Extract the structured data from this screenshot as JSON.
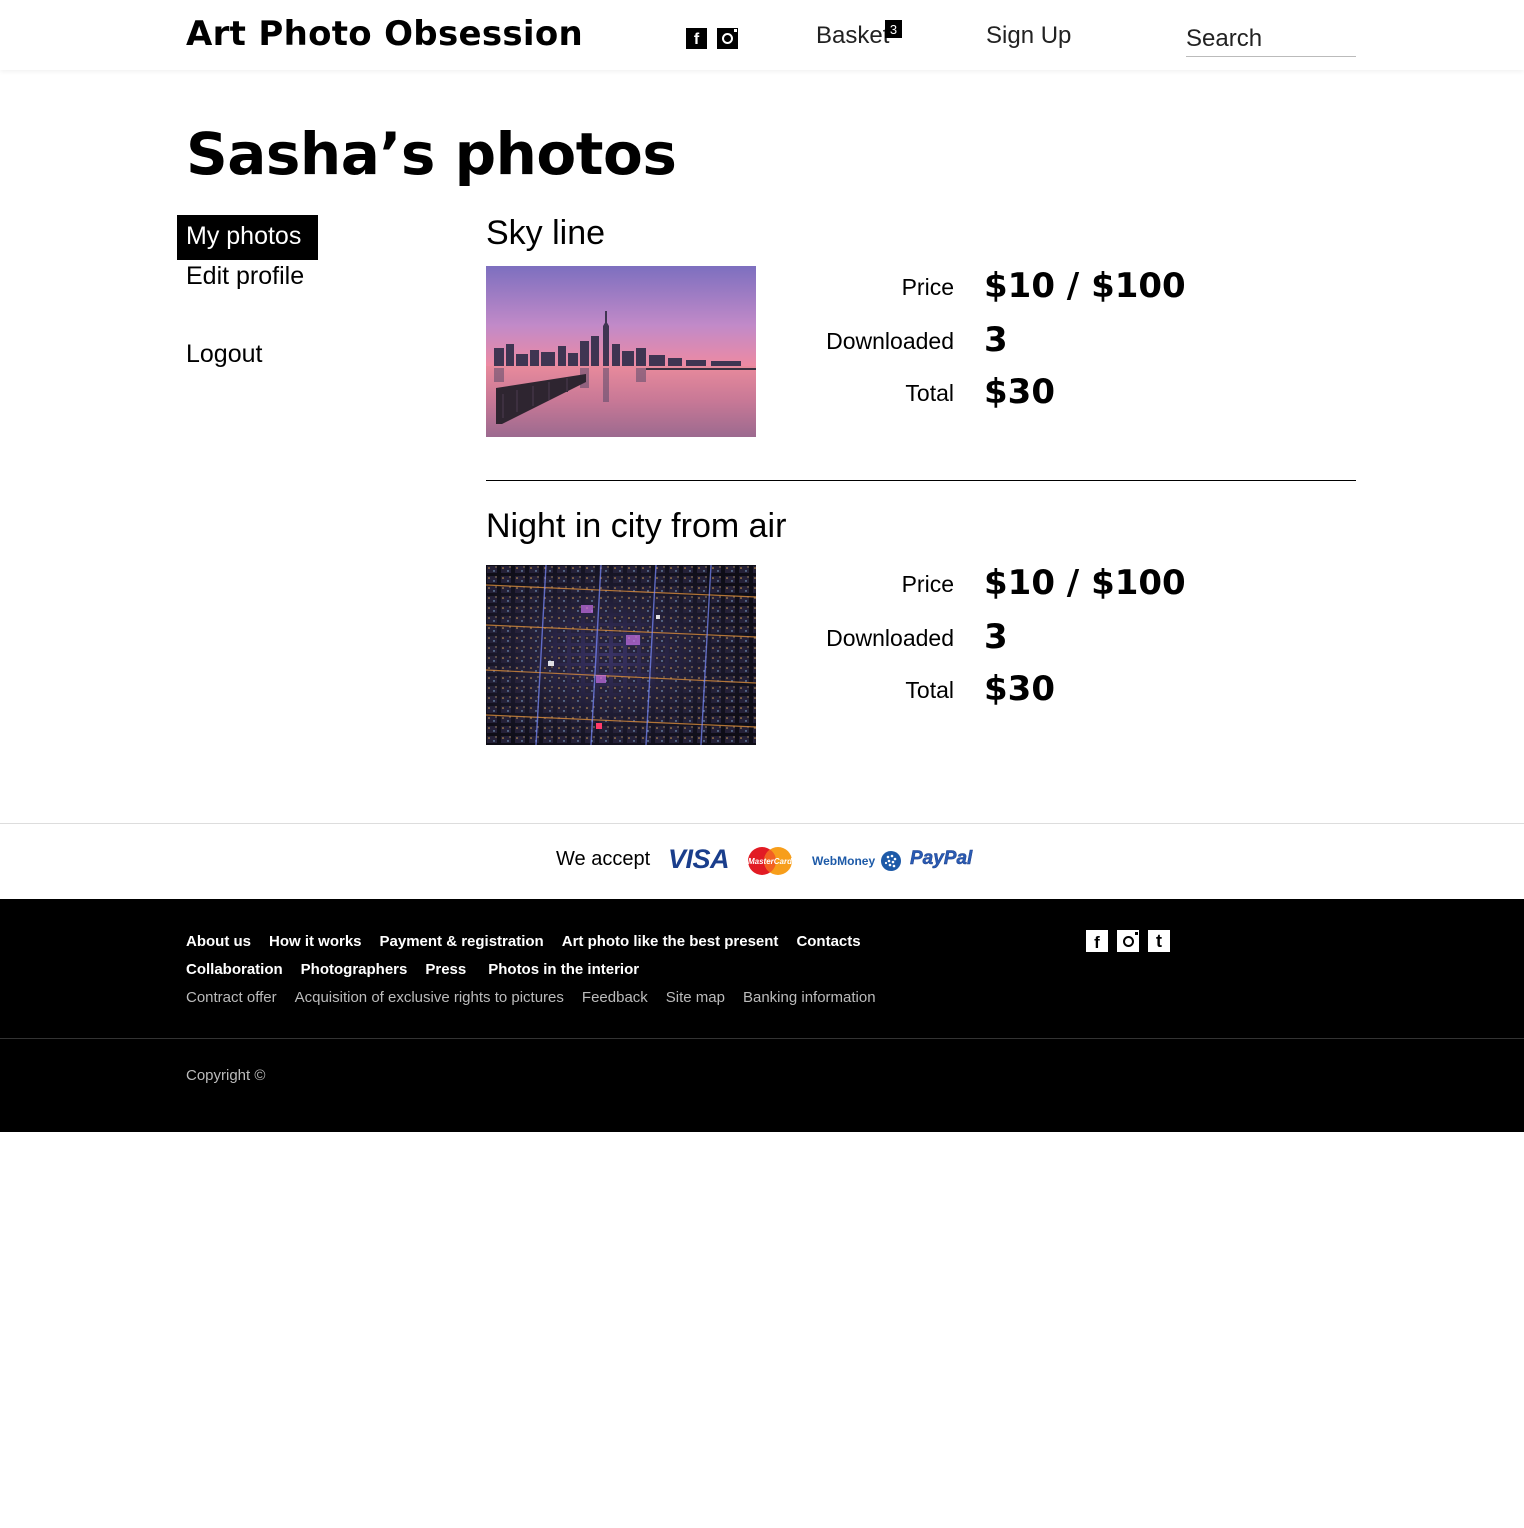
{
  "header": {
    "logo": "Art Photo Obsession",
    "social": [
      {
        "icon": "facebook-icon",
        "glyph": "f"
      },
      {
        "icon": "instagram-icon"
      }
    ],
    "basket_label": "Basket",
    "basket_count": "3",
    "signup_label": "Sign Up",
    "search_placeholder": "Search"
  },
  "page": {
    "title": "Sasha’s photos"
  },
  "sidebar": {
    "items": [
      {
        "label": "My photos",
        "active": true
      },
      {
        "label": "Edit profile",
        "active": false
      },
      {
        "label": "Logout",
        "active": false
      }
    ]
  },
  "photos": [
    {
      "title": "Sky line",
      "price_label": "Price",
      "price_value": "$10 / $100",
      "downloaded_label": "Downloaded",
      "downloaded_value": "3",
      "total_label": "Total",
      "total_value": "$30"
    },
    {
      "title": "Night in city from air",
      "price_label": "Price",
      "price_value": "$10 / $100",
      "downloaded_label": "Downloaded",
      "downloaded_value": "3",
      "total_label": "Total",
      "total_value": "$30"
    }
  ],
  "payments": {
    "label": "We accept",
    "methods": [
      "VISA",
      "MasterCard",
      "WebMoney",
      "PayPal"
    ]
  },
  "footer": {
    "main_links_row1": [
      "About us",
      "How it works",
      "Payment & registration",
      "Art photo like the best present",
      "Contacts"
    ],
    "main_links_row2": [
      "Collaboration",
      "Photographers",
      "Press",
      "Photos in the interior"
    ],
    "sub_links": [
      "Contract offer",
      "Acquisition of exclusive rights to pictures",
      "Feedback",
      "Site map",
      "Banking information"
    ],
    "social": [
      {
        "icon": "facebook-icon",
        "glyph": "f"
      },
      {
        "icon": "instagram-icon"
      },
      {
        "icon": "tumblr-icon",
        "glyph": "t"
      }
    ],
    "copyright": "Copyright ©"
  },
  "colors": {
    "accent": "#000000",
    "footer_bg": "#000000",
    "footer_muted_text": "#bbbbbb",
    "visa_blue": "#1a3e8c",
    "mastercard_red": "#e21b24",
    "mastercard_orange": "#f79e1b",
    "webmoney_blue": "#1d5aa8",
    "paypal_blue": "#2a5bb4"
  }
}
